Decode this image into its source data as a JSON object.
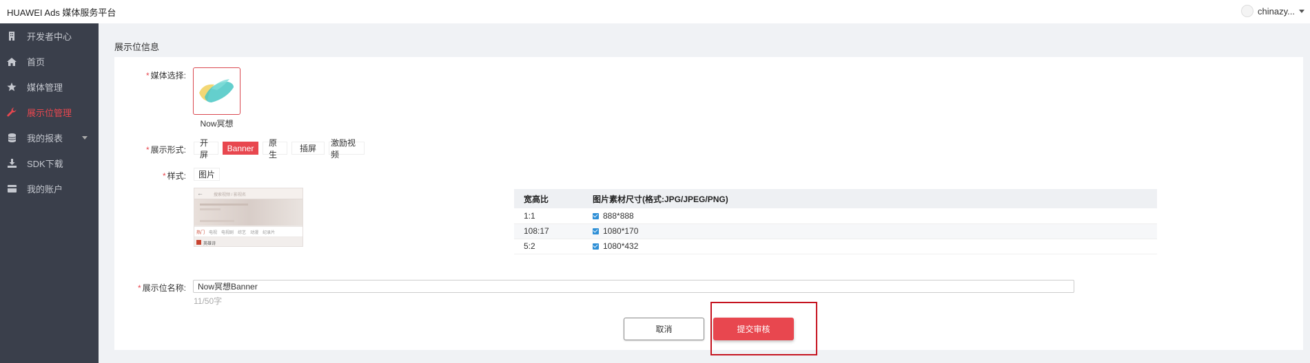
{
  "header": {
    "brand": "HUAWEI Ads 媒体服务平台",
    "username": "chinazy..."
  },
  "sidebar": {
    "items": [
      {
        "label": "开发者中心",
        "icon": "building-icon"
      },
      {
        "label": "首页",
        "icon": "home-icon"
      },
      {
        "label": "媒体管理",
        "icon": "star-icon"
      },
      {
        "label": "展示位管理",
        "icon": "wrench-icon",
        "active": true
      },
      {
        "label": "我的报表",
        "icon": "database-icon",
        "has_submenu": true
      },
      {
        "label": "SDK下载",
        "icon": "download-icon"
      },
      {
        "label": "我的账户",
        "icon": "card-icon"
      }
    ]
  },
  "section_title": "展示位信息",
  "form": {
    "media_label": "媒体选择:",
    "media_name": "Now冥想",
    "format_label": "展示形式:",
    "formats": [
      "开屏",
      "Banner",
      "原生",
      "插屏",
      "激励视频"
    ],
    "active_format": "Banner",
    "style_label": "样式:",
    "style_value": "图片",
    "name_label": "展示位名称:",
    "name_value": "Now冥想Banner",
    "counter": "11/50字"
  },
  "size_table": {
    "headers": [
      "宽高比",
      "图片素材尺寸(格式:JPG/JPEG/PNG)"
    ],
    "rows": [
      {
        "ratio": "1:1",
        "size": "888*888"
      },
      {
        "ratio": "108:17",
        "size": "1080*170"
      },
      {
        "ratio": "5:2",
        "size": "1080*432"
      }
    ]
  },
  "preview": {
    "search_placeholder": "搜索视频 / 影视名",
    "tabs": [
      "热门",
      "电视",
      "电视剧",
      "综艺",
      "动漫",
      "纪录片"
    ],
    "row_text": "英雄诗"
  },
  "actions": {
    "cancel": "取消",
    "submit": "提交审核"
  },
  "colors": {
    "accent": "#e8474f",
    "sidebar_bg": "#3a3f4b",
    "highlight": "#c5131f"
  }
}
